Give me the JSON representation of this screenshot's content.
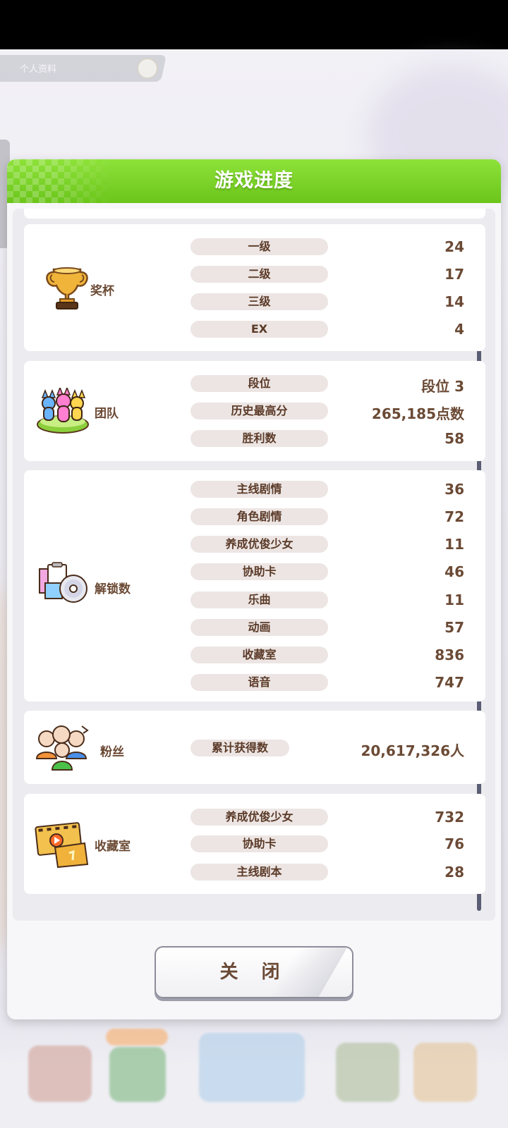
{
  "header_pill": {
    "label": "个人资料"
  },
  "dialog": {
    "title": "游戏进度",
    "close_label": "关 闭"
  },
  "sections": {
    "trophy": {
      "label": "奖杯",
      "icon": "trophy-icon",
      "rows": [
        {
          "label": "一级",
          "value": "24"
        },
        {
          "label": "二级",
          "value": "17"
        },
        {
          "label": "三级",
          "value": "14"
        },
        {
          "label": "EX",
          "value": "4"
        }
      ]
    },
    "team": {
      "label": "团队",
      "icon": "team-figures-icon",
      "rows": [
        {
          "label": "段位",
          "value": "段位 3"
        },
        {
          "label": "历史最高分",
          "value": "265,185点数"
        },
        {
          "label": "胜利数",
          "value": "58"
        }
      ]
    },
    "unlocks": {
      "label": "解锁数",
      "icon": "unlock-collection-icon",
      "rows": [
        {
          "label": "主线剧情",
          "value": "36"
        },
        {
          "label": "角色剧情",
          "value": "72"
        },
        {
          "label": "养成优俊少女",
          "value": "11"
        },
        {
          "label": "协助卡",
          "value": "46"
        },
        {
          "label": "乐曲",
          "value": "11"
        },
        {
          "label": "动画",
          "value": "57"
        },
        {
          "label": "收藏室",
          "value": "836"
        },
        {
          "label": "语音",
          "value": "747"
        }
      ]
    },
    "fans": {
      "label": "粉丝",
      "icon": "fans-group-icon",
      "rows": [
        {
          "label": "累计获得数",
          "value": "20,617,326人"
        }
      ]
    },
    "collection": {
      "label": "收藏室",
      "icon": "film-folder-icon",
      "rows": [
        {
          "label": "养成优俊少女",
          "value": "732"
        },
        {
          "label": "协助卡",
          "value": "76"
        },
        {
          "label": "主线剧本",
          "value": "28"
        }
      ]
    }
  },
  "colors": {
    "header_green": "#7ed42b",
    "text_brown": "#6b4a35",
    "pill_bg": "#ece5e3"
  }
}
